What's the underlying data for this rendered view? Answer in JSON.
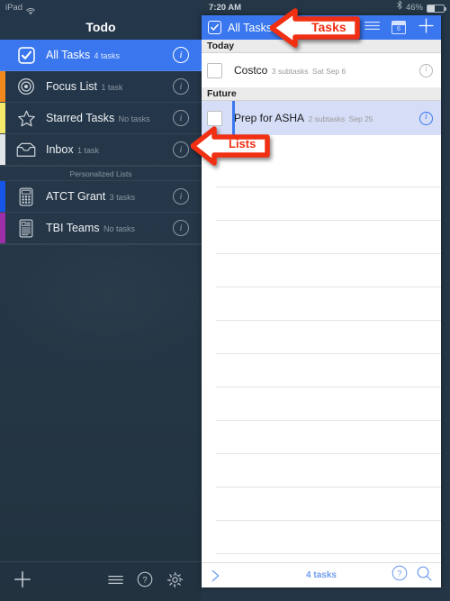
{
  "statusbar": {
    "device": "iPad",
    "wifi_icon": "wifi-icon",
    "time": "7:20 AM",
    "bluetooth_icon": "bluetooth-icon",
    "battery_percent": "46%",
    "battery_icon": "battery-icon"
  },
  "sidebar": {
    "title": "Todo",
    "section_header": "Personalized Lists",
    "items": [
      {
        "label": "All Tasks",
        "count": "4 tasks",
        "icon": "checkbox-icon",
        "swatch": "",
        "selected": true,
        "info": "i"
      },
      {
        "label": "Focus List",
        "count": "1 task",
        "icon": "target-icon",
        "swatch": "#f08a1e",
        "selected": false,
        "info": "i"
      },
      {
        "label": "Starred Tasks",
        "count": "No tasks",
        "icon": "star-icon",
        "swatch": "#f5e96b",
        "selected": false,
        "info": "i"
      },
      {
        "label": "Inbox",
        "count": "1 task",
        "icon": "inbox-icon",
        "swatch": "#e3e6e8",
        "selected": false,
        "info": "i"
      }
    ],
    "personal_items": [
      {
        "label": "ATCT Grant",
        "count": "3 tasks",
        "icon": "calculator-icon",
        "swatch": "#1555e8",
        "info": "i"
      },
      {
        "label": "TBI Teams",
        "count": "No tasks",
        "icon": "document-icon",
        "swatch": "#9c2fa8",
        "info": "i"
      }
    ],
    "toolbar": {
      "add_label": "+",
      "menu_icon": "hamburger-menu-icon",
      "help_icon": "help-icon",
      "settings_icon": "gear-icon"
    }
  },
  "panel": {
    "header": {
      "checkbox_icon": "checked-checkbox-icon",
      "title": "All Tasks",
      "menu_icon": "hamburger-menu-icon",
      "calendar_icon": "calendar-icon",
      "calendar_badge": "6",
      "add_icon": "plus-icon"
    },
    "groups": [
      {
        "title": "Today",
        "tasks": [
          {
            "title": "Costco",
            "subtasks": "3 subtasks",
            "date": "Sat Sep 6",
            "highlight": false,
            "accent": false,
            "info": "i"
          }
        ]
      },
      {
        "title": "Future",
        "tasks": [
          {
            "title": "Prep for ASHA",
            "subtasks": "2 subtasks",
            "date": "Sep 25",
            "highlight": true,
            "accent": true,
            "info": "i"
          }
        ]
      }
    ],
    "empty_row_count": 13,
    "footer": {
      "expand_icon": "chevron-right-icon",
      "count_label": "4 tasks",
      "help_icon": "help-icon",
      "search_icon": "search-icon"
    }
  },
  "annotations": [
    {
      "label": "Tasks",
      "direction": "left",
      "color": "#f02f13"
    },
    {
      "label": "Lists",
      "direction": "left",
      "color": "#f02f13"
    }
  ],
  "colors": {
    "accent_blue": "#3a77ef",
    "sidebar_bg": "#253747",
    "highlight_row": "#d5ddf7",
    "annotation_red": "#f02f13"
  }
}
